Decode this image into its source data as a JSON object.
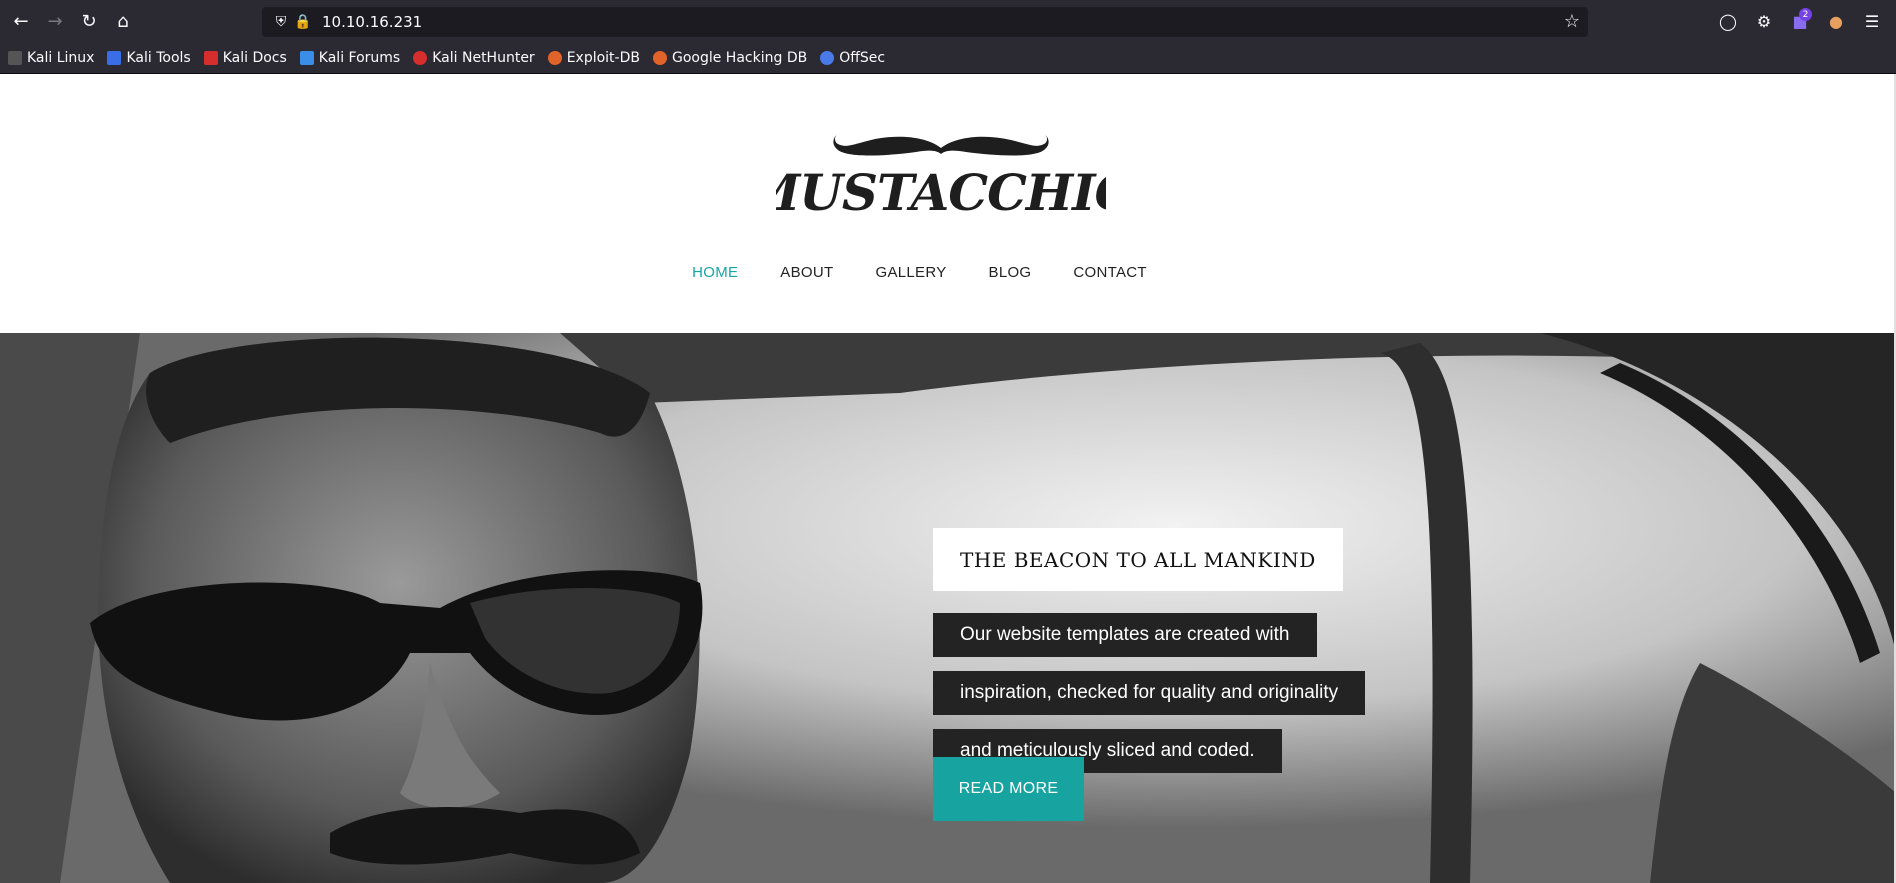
{
  "browser": {
    "url": "10.10.16.231",
    "extension_badge": "2",
    "bookmarks": [
      {
        "label": "Kali Linux",
        "color": "#2b2a33"
      },
      {
        "label": "Kali Tools",
        "color": "#3a6ee8"
      },
      {
        "label": "Kali Docs",
        "color": "#d62d2d"
      },
      {
        "label": "Kali Forums",
        "color": "#3a8ee8"
      },
      {
        "label": "Kali NetHunter",
        "color": "#d62d2d"
      },
      {
        "label": "Exploit-DB",
        "color": "#e0632a"
      },
      {
        "label": "Google Hacking DB",
        "color": "#e0632a"
      },
      {
        "label": "OffSec",
        "color": "#4a7ae8"
      }
    ]
  },
  "site": {
    "logo_text": "MUSTACCHIO",
    "nav": {
      "home": "HOME",
      "about": "ABOUT",
      "gallery": "GALLERY",
      "blog": "BLOG",
      "contact": "CONTACT"
    },
    "accent_color": "#17a3a0",
    "hero": {
      "title": "THE BEACON TO ALL MANKIND",
      "lines": [
        "Our website templates are created with",
        "inspiration, checked for quality and originality",
        "and meticulously sliced and coded."
      ],
      "button": "READ MORE"
    }
  }
}
